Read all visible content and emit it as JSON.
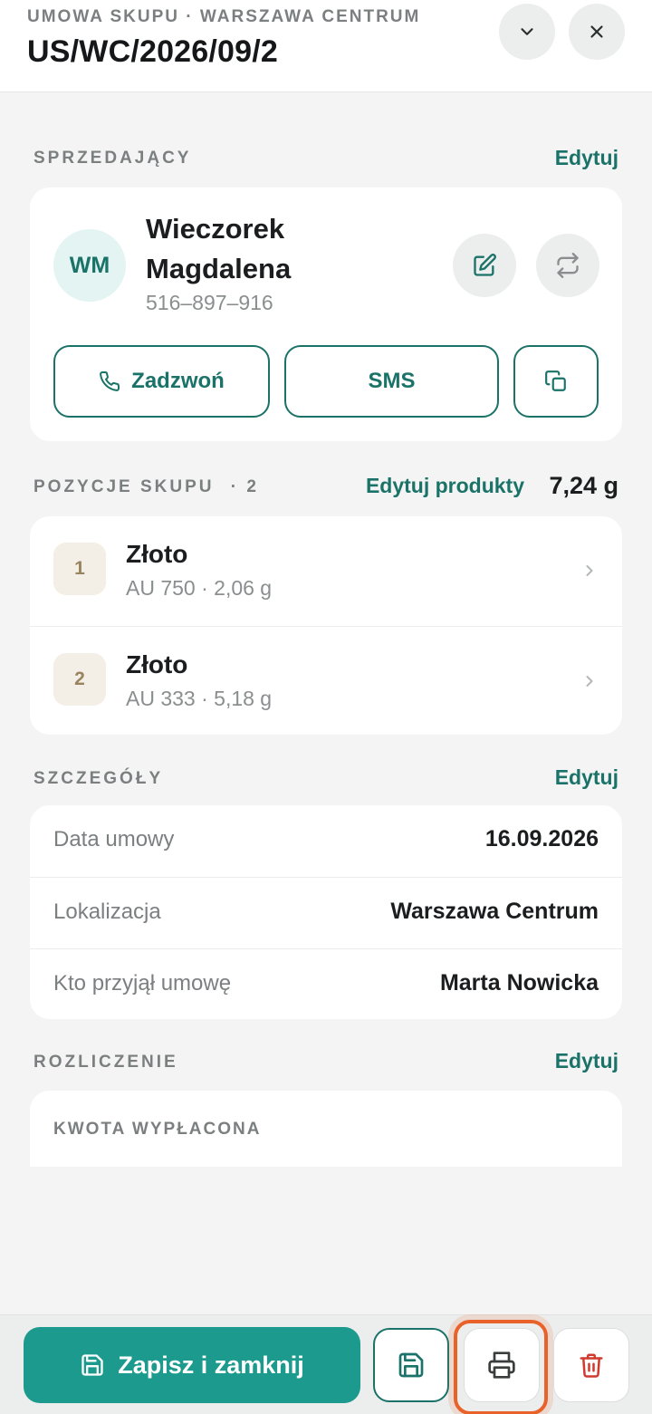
{
  "header": {
    "subtitle": "UMOWA SKUPU · WARSZAWA CENTRUM",
    "title": "US/WC/2026/09/2",
    "collapse_icon": "chevron-down-icon",
    "close_icon": "close-icon"
  },
  "seller": {
    "section_label": "SPRZEDAJĄCY",
    "edit_label": "Edytuj",
    "initials": "WM",
    "name": "Wieczorek Magdalena",
    "phone": "516–897–916",
    "call_label": "Zadzwoń",
    "sms_label": "SMS"
  },
  "items": {
    "section_label": "POZYCJE SKUPU",
    "count_label": "· 2",
    "edit_label": "Edytuj produkty",
    "total_weight": "7,24 g",
    "list": [
      {
        "num": "1",
        "name": "Złoto",
        "desc": "AU 750 · 2,06 g"
      },
      {
        "num": "2",
        "name": "Złoto",
        "desc": "AU 333 · 5,18 g"
      }
    ]
  },
  "details": {
    "section_label": "SZCZEGÓŁY",
    "edit_label": "Edytuj",
    "rows": [
      {
        "label": "Data umowy",
        "value": "16.09.2026"
      },
      {
        "label": "Lokalizacja",
        "value": "Warszawa Centrum"
      },
      {
        "label": "Kto przyjął umowę",
        "value": "Marta Nowicka"
      }
    ]
  },
  "settlement": {
    "section_label": "ROZLICZENIE",
    "edit_label": "Edytuj",
    "amount_label": "KWOTA WYPŁACONA"
  },
  "footer": {
    "save_close_label": "Zapisz i zamknij"
  },
  "colors": {
    "accent": "#1a7268",
    "primary_button": "#1c9a8e",
    "highlight": "#e8622a",
    "danger": "#d03a2f"
  }
}
